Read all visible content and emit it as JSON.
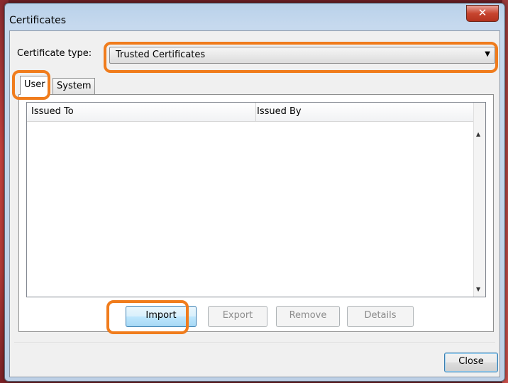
{
  "window": {
    "title": "Certificates",
    "close_glyph": "✕"
  },
  "certificate_type": {
    "label": "Certificate type:",
    "value": "Trusted Certificates"
  },
  "tabs": [
    {
      "label": "User",
      "active": true
    },
    {
      "label": "System",
      "active": false
    }
  ],
  "table": {
    "columns": [
      "Issued To",
      "Issued By"
    ],
    "rows": []
  },
  "buttons": {
    "import": "Import",
    "export": "Export",
    "remove": "Remove",
    "details": "Details",
    "close": "Close"
  },
  "highlight_color": "#f07c1c"
}
